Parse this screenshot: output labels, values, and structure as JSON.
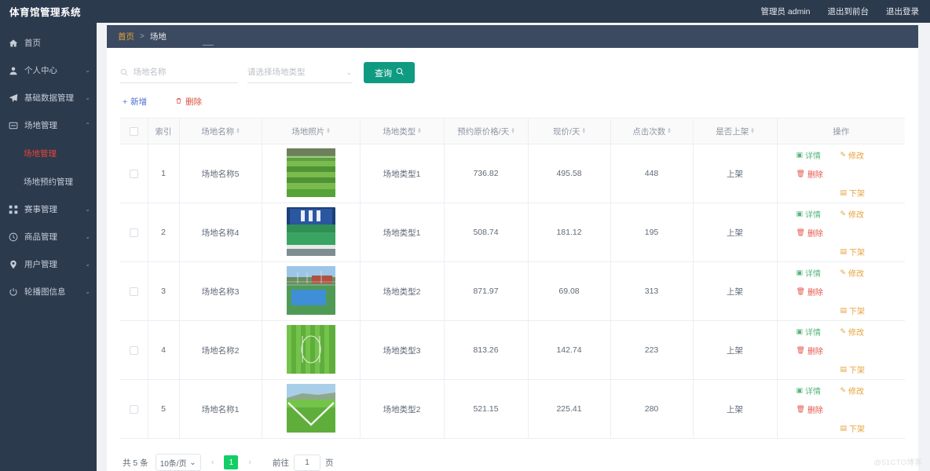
{
  "app": {
    "title": "体育馆管理系统",
    "accent_green": "#0f9b82",
    "sidebar_bg": "#2c3a4d",
    "active_color": "#e8433a"
  },
  "topbar": {
    "user": "管理员 admin",
    "exit_front": "退出到前台",
    "logout": "退出登录"
  },
  "breadcrumb": {
    "home": "首页",
    "separator": ">",
    "current": "场地"
  },
  "sidebar": {
    "items": [
      {
        "label": "首页",
        "icon": "home-icon",
        "arrow": ""
      },
      {
        "label": "个人中心",
        "icon": "user-icon",
        "arrow": "⌄"
      },
      {
        "label": "基础数据管理",
        "icon": "send-icon",
        "arrow": "⌄"
      },
      {
        "label": "场地管理",
        "icon": "card-icon",
        "arrow": "⌃"
      },
      {
        "label": "赛事管理",
        "icon": "grid-icon",
        "arrow": "⌄"
      },
      {
        "label": "商品管理",
        "icon": "compass-icon",
        "arrow": "⌄"
      },
      {
        "label": "用户管理",
        "icon": "pin-icon",
        "arrow": "⌄"
      },
      {
        "label": "轮播图信息",
        "icon": "power-icon",
        "arrow": "⌄"
      }
    ],
    "submenu": [
      {
        "label": "场地管理",
        "active": true
      },
      {
        "label": "场地预约管理",
        "active": false
      }
    ]
  },
  "filter": {
    "name_placeholder": "场地名称",
    "name_value": "",
    "type_placeholder": "请选择场地类型",
    "type_value": "",
    "search_label": "查询",
    "search_icon": "search-icon",
    "caret_icon": "chevron-down-icon"
  },
  "actions": {
    "add_label": "新增",
    "add_icon": "plus-icon",
    "delete_label": "删除",
    "delete_icon": "trash-icon"
  },
  "table": {
    "columns": [
      {
        "key": "checkbox",
        "label": "",
        "sortable": false
      },
      {
        "key": "index",
        "label": "索引",
        "sortable": false
      },
      {
        "key": "name",
        "label": "场地名称",
        "sortable": true
      },
      {
        "key": "photo",
        "label": "场地照片",
        "sortable": true
      },
      {
        "key": "type",
        "label": "场地类型",
        "sortable": true
      },
      {
        "key": "orig_price",
        "label": "预约原价格/天",
        "sortable": true
      },
      {
        "key": "price",
        "label": "现价/天",
        "sortable": true
      },
      {
        "key": "clicks",
        "label": "点击次数",
        "sortable": true
      },
      {
        "key": "listed",
        "label": "是否上架",
        "sortable": true
      },
      {
        "key": "ops",
        "label": "操作",
        "sortable": false
      }
    ],
    "rows": [
      {
        "index": "1",
        "name": "场地名称5",
        "photo": "grass-field",
        "type": "场地类型1",
        "orig_price": "736.82",
        "price": "495.58",
        "clicks": "448",
        "listed": "上架"
      },
      {
        "index": "2",
        "name": "场地名称4",
        "photo": "indoor-court",
        "type": "场地类型1",
        "orig_price": "508.74",
        "price": "181.12",
        "clicks": "195",
        "listed": "上架"
      },
      {
        "index": "3",
        "name": "场地名称3",
        "photo": "tennis-court",
        "type": "场地类型2",
        "orig_price": "871.97",
        "price": "69.08",
        "clicks": "313",
        "listed": "上架"
      },
      {
        "index": "4",
        "name": "场地名称2",
        "photo": "striped-pitch",
        "type": "场地类型3",
        "orig_price": "813.26",
        "price": "142.74",
        "clicks": "223",
        "listed": "上架"
      },
      {
        "index": "5",
        "name": "场地名称1",
        "photo": "corner-pitch",
        "type": "场地类型2",
        "orig_price": "521.15",
        "price": "225.41",
        "clicks": "280",
        "listed": "上架"
      }
    ],
    "ops": {
      "detail": "详情",
      "edit": "修改",
      "remove": "删除",
      "off_shelf": "下架"
    }
  },
  "pagination": {
    "total_text": "共 5 条",
    "page_size": "10条/页",
    "prev_icon": "chevron-left-icon",
    "next_icon": "chevron-right-icon",
    "current_page": "1",
    "jump_label": "前往",
    "jump_value": "1",
    "jump_unit": "页"
  },
  "watermark": "@51CTO博客"
}
